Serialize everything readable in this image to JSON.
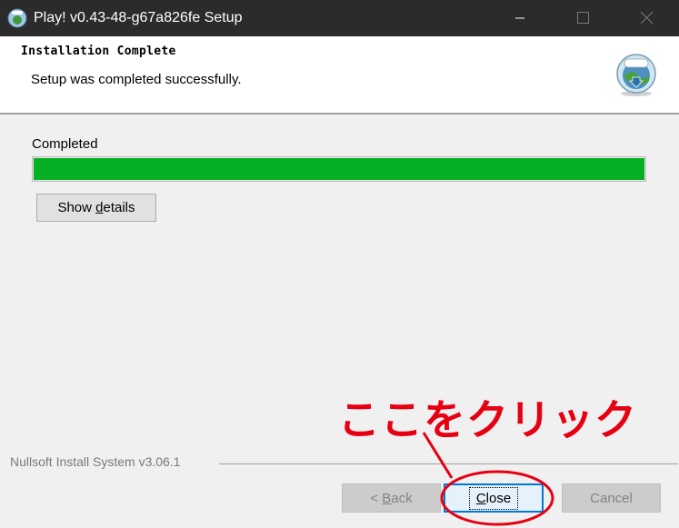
{
  "window": {
    "title": "Play! v0.43-48-g67a826fe Setup"
  },
  "header": {
    "title": "Installation Complete",
    "subtitle": "Setup was completed successfully."
  },
  "progress": {
    "label": "Completed",
    "value": 1.0,
    "color": "#06b025"
  },
  "show_details": {
    "pre": "Show ",
    "accel": "d",
    "post": "etails"
  },
  "footer": {
    "brand": "Nullsoft Install System v3.06.1"
  },
  "buttons": {
    "back": {
      "pre": "< ",
      "accel": "B",
      "post": "ack"
    },
    "close": {
      "accel": "C",
      "post": "lose"
    },
    "cancel": "Cancel"
  },
  "annotation": {
    "text": "ここをクリック",
    "color": "#e60012"
  }
}
